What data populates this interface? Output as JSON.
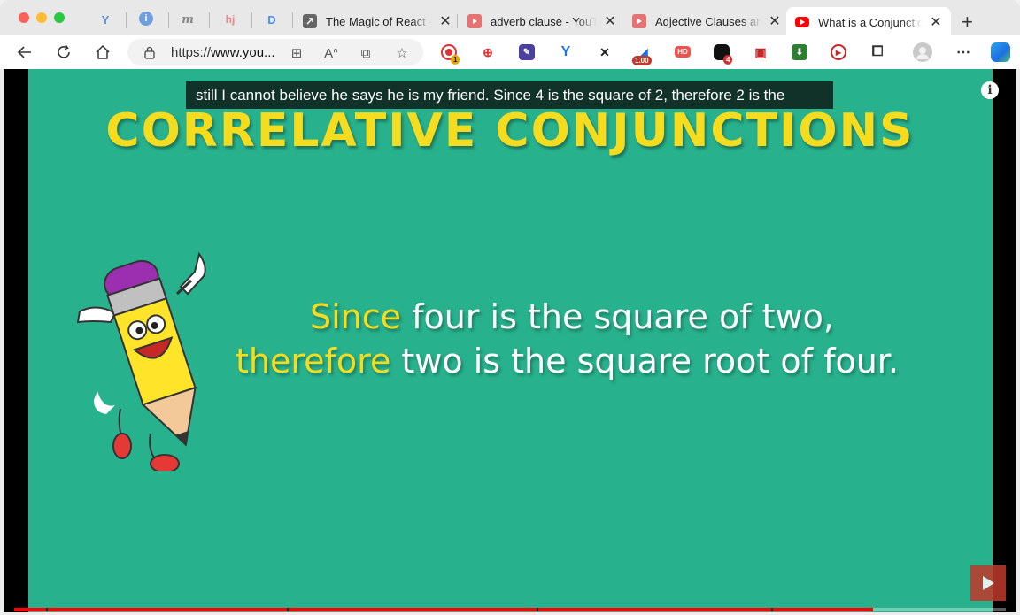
{
  "tabs": [
    {
      "title": "The Magic of React -",
      "favicon": "arrow-link-icon",
      "active": false
    },
    {
      "title": "adverb clause - YouTube",
      "favicon": "youtube-icon",
      "active": false
    },
    {
      "title": "Adjective Clauses and",
      "favicon": "youtube-icon",
      "active": false
    },
    {
      "title": "What is a Conjunction",
      "favicon": "youtube-icon",
      "active": true
    }
  ],
  "pinned_tabs": [
    "vimeo-like-icon",
    "info-icon",
    "m-icon",
    "hj-icon",
    "d-icon"
  ],
  "pinned_glyphs": [
    "Y",
    "i",
    "m",
    "hj",
    "D"
  ],
  "toolbar": {
    "url_prefix": "https://",
    "url_domain": "www.you...",
    "zoom_badge": "1.00",
    "hd_badge": "HD",
    "ext_badge_1": "1",
    "ext_badge_4": "4"
  },
  "video": {
    "caption": "still I cannot believe he says he is my friend.  Since 4 is the square of 2, therefore 2 is the",
    "heading": "CORRELATIVE CONJUNCTIONS",
    "line1_keyword": "Since",
    "line1_rest": " four is the square of two,",
    "line2_keyword": "therefore",
    "line2_rest": " two is the square root of four.",
    "info_glyph": "i",
    "progress": 0.866
  },
  "colors": {
    "slide_bg": "#28b18d",
    "heading": "#f6dc1e",
    "youtube_red": "#ff0000"
  }
}
